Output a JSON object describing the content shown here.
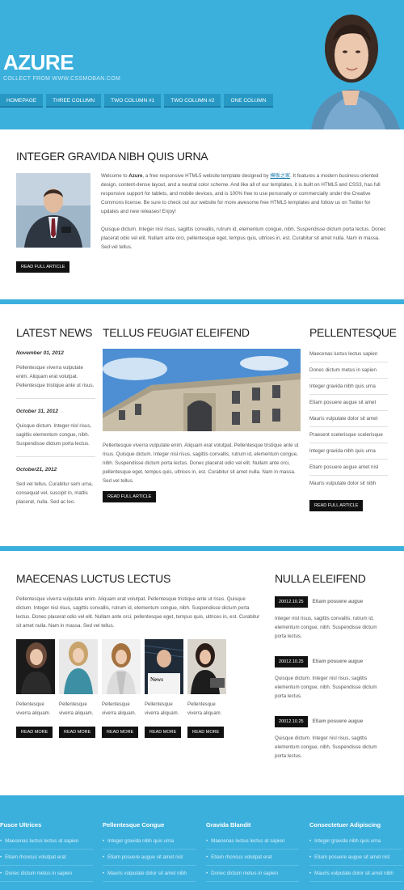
{
  "header": {
    "logo": "AZURE",
    "tagline": "COLLECT FROM WWW.CSSMOBAN.COM",
    "nav": [
      "HOMEPAGE",
      "THREE COLUMN",
      "TWO COLUMN #1",
      "TWO COLUMN #2",
      "ONE COLUMN"
    ]
  },
  "intro": {
    "title": "INTEGER GRAVIDA NIBH QUIS URNA",
    "p1_pre": "Welcome to ",
    "p1_brand": "Azure",
    "p1_mid": ", a free responsive HTML5 website template designed by ",
    "p1_link": "模板之家",
    "p1_post": ". It features a modern business-oriented design, content-dense layout, and a neutral color scheme. And like all of our templates, it is built on HTML5 and CSS3, has full responsive support for tablets, and mobile devices, and is 100% free to use personally or commercially under the Creative Commons license. Be sure to check out our website for more awesome free HTML5 templates and follow us on Twitter for updates and new releases! Enjoy!",
    "p2": "Quisque dictum. Integer nisl risus, sagittis convallis, rutrum id, elementum congue, nibh. Suspendisse dictum porta lectus. Donec placerat odio vel elit. Nullam ante orci, pellentesque eget, tempus quis, ultrices in, est. Curabitur sit amet nulla. Nam in massa. Sed vel tellus.",
    "button": "READ FULL ARTICLE"
  },
  "latest": {
    "title": "LATEST NEWS",
    "items": [
      {
        "date": "November 01, 2012",
        "text": "Pellentesque viverra vulputate enim. Aliquam erat volutpat. Pellentesque tristique ante ut risus."
      },
      {
        "date": "October 31, 2012",
        "text": "Quisque dictum. Integer nisl risus, sagittis elementum congue, nibh. Suspendisse dictum porta lectus."
      },
      {
        "date": "October21, 2012",
        "text": "Sed vel tellus. Curabitur sem urna, consequat vel, suscipit in, mattis placerat, nulla. Sed ac leo."
      }
    ]
  },
  "tellus": {
    "title": "TELLUS FEUGIAT ELEIFEND",
    "text": "Pellentesque viverra vulputate enim. Aliquam erat volutpat. Pellentesque tristique ante ut risus. Quisque dictum. Integer nisl risus, sagittis convallis, rutrum id, elementum congue, nibh. Suspendisse dictum porta lectus. Donec placerat odio vel elit. Nullam ante orci, pellentesque eget, tempus quis, ultrices in, est. Curabitur sit amet nulla. Nam in massa. Sed vel tellus.",
    "button": "READ FULL ARTICLE"
  },
  "pellentesque": {
    "title": "PELLENTESQUE",
    "items": [
      "Maecenas luctus lectus sapien",
      "Donec dictum metus in sapien",
      "Integer gravida nibh quis urna",
      "Etiam posuere augue sit amet",
      "Mauris vulputate dolor sit amet",
      "Praesent scelerisque scelerisque",
      "Integer gravida nibh quis urna",
      "Etiam posuere augue amet nisl",
      "Mauris vulputate dolor sit nibh"
    ],
    "button": "READ FULL ARTICLE"
  },
  "maecenas": {
    "title": "MAECENAS LUCTUS LECTUS",
    "text": "Pellentesque viverra vulputate enim. Aliquam erat volutpat. Pellentesque tristique ante ut risus. Quisque dictum. Integer nisl risus, sagittis convallis, rutrum id, elementum congue, nibh. Suspendisse dictum porta lectus. Donec placerat odio vel elit. Nullam ante orci, pellentesque eget, tempus quis, ultrices in, est. Curabitur sit amet nulla. Nam in massa. Sed vel tellus.",
    "thumbs": [
      {
        "caption": "Pellentesque viverra aliquam.",
        "button": "READ MORE"
      },
      {
        "caption": "Pellentesque viverra aliquam.",
        "button": "READ MORE"
      },
      {
        "caption": "Pellentesque viverra aliquam.",
        "button": "READ MORE"
      },
      {
        "caption": "Pellentesque viverra aliquam.",
        "button": "READ MORE"
      },
      {
        "caption": "Pellentesque viverra aliquam.",
        "button": "READ MORE"
      }
    ]
  },
  "nulla": {
    "title": "NULLA ELEIFEND",
    "items": [
      {
        "date": "20012.10.25",
        "title": "Etiam posuere augue",
        "text": "Integer nisl risus, sagittis convallis, rutrum id, elementum congue, nibh. Suspendisse dictum porta lectus."
      },
      {
        "date": "20012.10.25",
        "title": "Etiam posuere augue",
        "text": "Quisque dictum. Integer nisl risus, sagittis elementum congue, nibh. Suspendisse dictum porta lectus."
      },
      {
        "date": "20012.10.25",
        "title": "Etiam posuere augue",
        "text": "Quisque dictum. Integer nisl risus, sagittis elementum congue, nibh. Suspendisse dictum porta lectus."
      }
    ]
  },
  "footer": {
    "cols": [
      {
        "title": "Fusce Ultrices",
        "items": [
          "Maecenas luctus lectus at sapien",
          "Etiam rhoncus volutpat erat",
          "Donec dictum metus in sapien"
        ]
      },
      {
        "title": "Pellentesque Congue",
        "items": [
          "Integer gravida nibh quis urna",
          "Etiam posuere augue sit amet nisl",
          "Mauris vulputate dolor sit amet nibh"
        ]
      },
      {
        "title": "Gravida Blandit",
        "items": [
          "Maecenas luctus lectus at sapien",
          "Etiam rhoncus volutpat erat",
          "Donec dictum metus in sapien"
        ]
      },
      {
        "title": "Consectetuer Adipiscing",
        "items": [
          "Integer gravida nibh quis urna",
          "Etiam posuere augue sit amet nisl",
          "Mauris vulputate dolor sit amet nibh"
        ]
      }
    ]
  },
  "colors": {
    "accent": "#3cb0dd",
    "nav": "#2798c4",
    "button": "#111111"
  }
}
